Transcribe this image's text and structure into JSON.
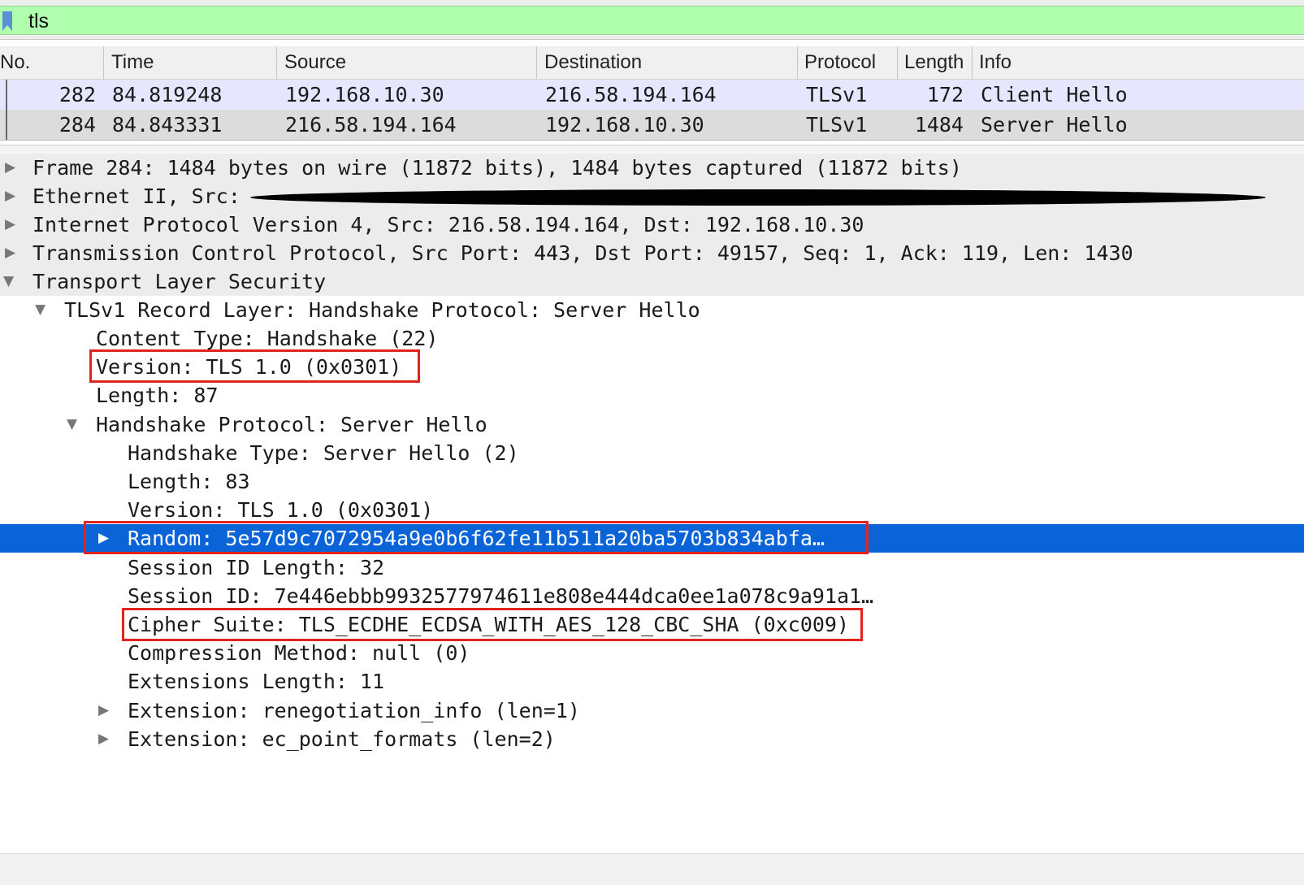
{
  "filter": {
    "value": "tls",
    "bookmark_icon": "bookmark-icon"
  },
  "packet_list": {
    "columns": [
      "No.",
      "Time",
      "Source",
      "Destination",
      "Protocol",
      "Length",
      "Info"
    ],
    "rows": [
      {
        "no": "282",
        "time": "84.819248",
        "source": "192.168.10.30",
        "destination": "216.58.194.164",
        "protocol": "TLSv1",
        "length": "172",
        "info": "Client Hello"
      },
      {
        "no": "284",
        "time": "84.843331",
        "source": "216.58.194.164",
        "destination": "192.168.10.30",
        "protocol": "TLSv1",
        "length": "1484",
        "info": "Server Hello"
      }
    ]
  },
  "details": [
    {
      "text": "Frame 284: 1484 bytes on wire (11872 bits), 1484 bytes captured (11872 bits)",
      "state": "collapsed"
    },
    {
      "text": "Ethernet II, Src:",
      "state": "collapsed",
      "redacted": true
    },
    {
      "text": "Internet Protocol Version 4, Src: 216.58.194.164, Dst: 192.168.10.30",
      "state": "collapsed"
    },
    {
      "text": "Transmission Control Protocol, Src Port: 443, Dst Port: 49157, Seq: 1, Ack: 119, Len: 1430",
      "state": "collapsed"
    },
    {
      "text": "Transport Layer Security",
      "state": "expanded"
    },
    {
      "text": "TLSv1 Record Layer: Handshake Protocol: Server Hello",
      "state": "expanded"
    },
    {
      "text": "Content Type: Handshake (22)",
      "state": "leaf"
    },
    {
      "text": "Version: TLS 1.0 (0x0301)",
      "state": "leaf",
      "highlighted": true
    },
    {
      "text": "Length: 87",
      "state": "leaf"
    },
    {
      "text": "Handshake Protocol: Server Hello",
      "state": "expanded"
    },
    {
      "text": "Handshake Type: Server Hello (2)",
      "state": "leaf"
    },
    {
      "text": "Length: 83",
      "state": "leaf"
    },
    {
      "text": "Version: TLS 1.0 (0x0301)",
      "state": "leaf"
    },
    {
      "text": "Random: 5e57d9c7072954a9e0b6f62fe11b511a20ba5703b834abfa…",
      "state": "collapsed",
      "selected": true,
      "highlighted": true
    },
    {
      "text": "Session ID Length: 32",
      "state": "leaf"
    },
    {
      "text": "Session ID: 7e446ebbb9932577974611e808e444dca0ee1a078c9a91a1…",
      "state": "leaf"
    },
    {
      "text": "Cipher Suite: TLS_ECDHE_ECDSA_WITH_AES_128_CBC_SHA (0xc009)",
      "state": "leaf",
      "highlighted": true
    },
    {
      "text": "Compression Method: null (0)",
      "state": "leaf"
    },
    {
      "text": "Extensions Length: 11",
      "state": "leaf"
    },
    {
      "text": "Extension: renegotiation_info (len=1)",
      "state": "collapsed"
    },
    {
      "text": "Extension: ec_point_formats (len=2)",
      "state": "collapsed"
    }
  ],
  "colors": {
    "filter_valid": "#afffaf",
    "selection": "#0a64d8",
    "annotation": "#e3241c",
    "row_client_hello": "#e7e6ff",
    "row_server_hello": "#dcdcdc"
  },
  "icons": {
    "collapsed": "disclosure-triangle-right-icon",
    "expanded": "disclosure-triangle-down-icon"
  }
}
